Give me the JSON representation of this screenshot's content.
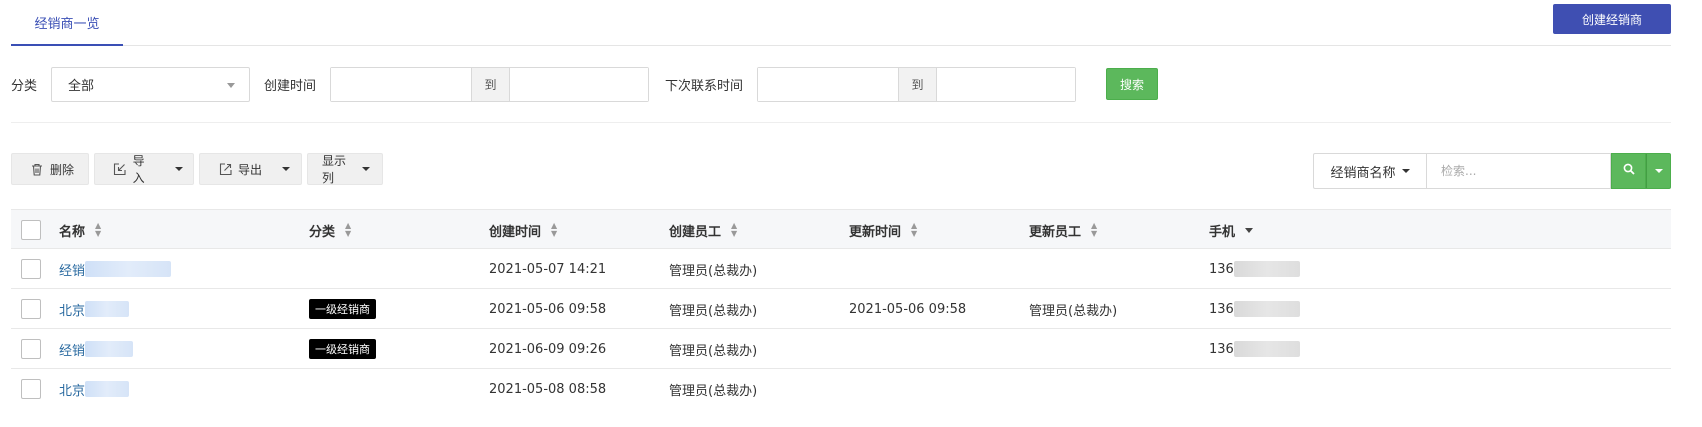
{
  "header": {
    "tab_label": "经销商一览",
    "create_button": "创建经销商"
  },
  "filter": {
    "category_label": "分类",
    "category_value": "全部",
    "created_time_label": "创建时间",
    "to_label": "到",
    "next_contact_label": "下次联系时间",
    "search_button": "搜索"
  },
  "toolbar": {
    "delete": "删除",
    "import": "导入",
    "export": "导出",
    "columns": "显示列"
  },
  "search": {
    "field": "经销商名称",
    "placeholder": "检索..."
  },
  "table": {
    "headers": [
      "名称",
      "分类",
      "创建时间",
      "创建员工",
      "更新时间",
      "更新员工",
      "手机"
    ],
    "rows": [
      {
        "name": "经销",
        "category": "",
        "created_at": "2021-05-07 14:21",
        "created_by": "管理员(总裁办)",
        "updated_at": "",
        "updated_by": "",
        "phone": "136"
      },
      {
        "name": "北京",
        "category": "一级经销商",
        "created_at": "2021-05-06 09:58",
        "created_by": "管理员(总裁办)",
        "updated_at": "2021-05-06 09:58",
        "updated_by": "管理员(总裁办)",
        "phone": "136"
      },
      {
        "name": "经销",
        "category": "一级经销商",
        "created_at": "2021-06-09 09:26",
        "created_by": "管理员(总裁办)",
        "updated_at": "",
        "updated_by": "",
        "phone": "136"
      },
      {
        "name": "北京",
        "category": "",
        "created_at": "2021-05-08 08:58",
        "created_by": "管理员(总裁办)",
        "updated_at": "",
        "updated_by": "",
        "phone": ""
      }
    ]
  },
  "colors": {
    "primary": "#3f4fb2",
    "success": "#5cb85c",
    "link": "#2a6aa0"
  }
}
